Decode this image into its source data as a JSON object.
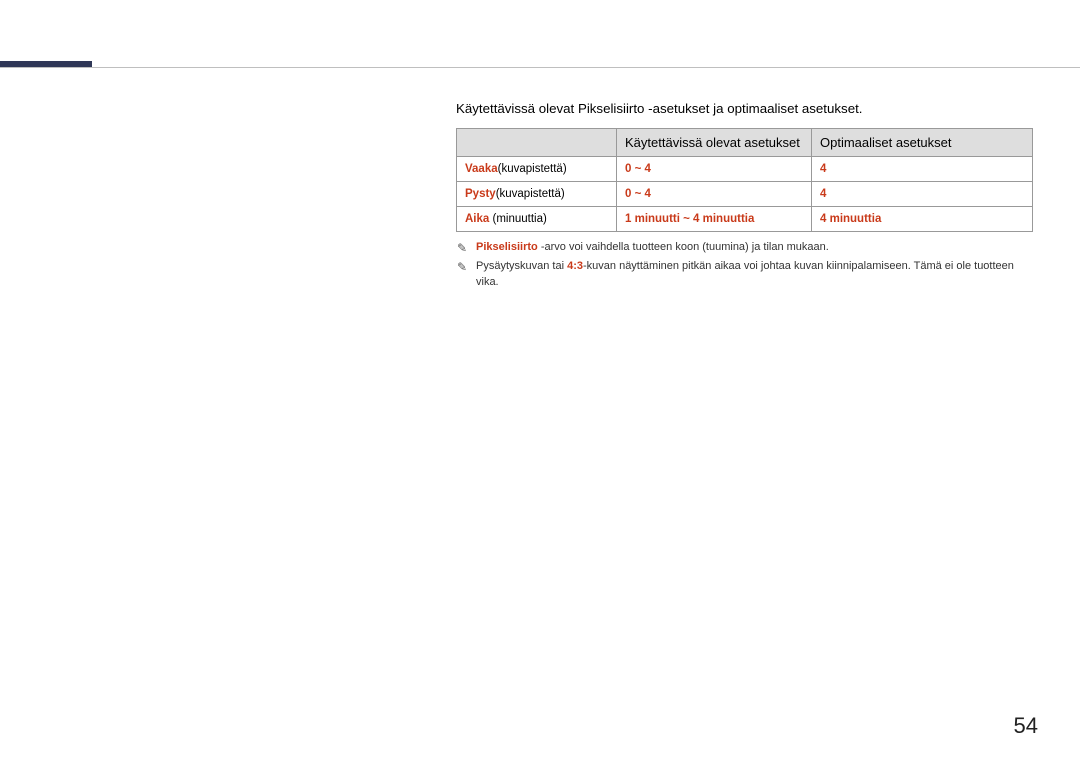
{
  "intro": "Käytettävissä olevat Pikselisiirto -asetukset ja optimaaliset asetukset.",
  "table": {
    "headers": {
      "col1": "",
      "col2": "Käytettävissä olevat asetukset",
      "col3": "Optimaaliset asetukset"
    },
    "rows": [
      {
        "label_highlight": "Vaaka",
        "label_rest": "(kuvapistettä)",
        "available": "0 ~ 4",
        "optimal": "4"
      },
      {
        "label_highlight": "Pysty",
        "label_rest": "(kuvapistettä)",
        "available": "0 ~ 4",
        "optimal": "4"
      },
      {
        "label_highlight": "Aika",
        "label_rest": " (minuuttia)",
        "available": "1 minuutti ~ 4 minuuttia",
        "optimal": "4 minuuttia"
      }
    ]
  },
  "notes": [
    {
      "highlight1": "Pikselisiirto",
      "text1": " -arvo voi vaihdella tuotteen koon (tuumina) ja tilan mukaan."
    },
    {
      "pre": "Pysäytyskuvan tai ",
      "highlight1": "4:3",
      "text1": "-kuvan näyttäminen pitkän aikaa voi johtaa kuvan kiinnipalamiseen. Tämä ei ole tuotteen vika."
    }
  ],
  "page_number": "54",
  "icon_glyph": "✎"
}
